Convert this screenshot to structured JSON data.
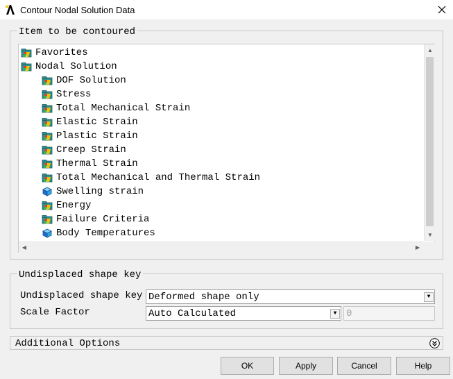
{
  "window": {
    "title": "Contour Nodal Solution Data"
  },
  "icons": {
    "logo": "ansys-logo-icon",
    "close": "close-icon",
    "folder": "folder-icon",
    "leaf": "cube-icon",
    "expand": "double-chevron-down-icon"
  },
  "colors": {
    "logo_yellow": "#f7c600",
    "folder_teal": "#2f8f8f",
    "leaf_blue": "#1e6fd0"
  },
  "item_group": {
    "legend": "Item to be contoured",
    "tree": [
      {
        "label": "Favorites",
        "level": 0,
        "icon": "folder"
      },
      {
        "label": "Nodal Solution",
        "level": 0,
        "icon": "folder-open"
      },
      {
        "label": "DOF Solution",
        "level": 1,
        "icon": "folder"
      },
      {
        "label": "Stress",
        "level": 1,
        "icon": "folder"
      },
      {
        "label": "Total Mechanical Strain",
        "level": 1,
        "icon": "folder"
      },
      {
        "label": "Elastic Strain",
        "level": 1,
        "icon": "folder"
      },
      {
        "label": "Plastic Strain",
        "level": 1,
        "icon": "folder"
      },
      {
        "label": "Creep Strain",
        "level": 1,
        "icon": "folder"
      },
      {
        "label": "Thermal Strain",
        "level": 1,
        "icon": "folder"
      },
      {
        "label": "Total Mechanical and Thermal Strain",
        "level": 1,
        "icon": "folder"
      },
      {
        "label": "Swelling strain",
        "level": 1,
        "icon": "leaf"
      },
      {
        "label": "Energy",
        "level": 1,
        "icon": "folder"
      },
      {
        "label": "Failure Criteria",
        "level": 1,
        "icon": "folder"
      },
      {
        "label": "Body Temperatures",
        "level": 1,
        "icon": "leaf"
      }
    ]
  },
  "shape_group": {
    "legend": "Undisplaced shape key",
    "shape_key_label": "Undisplaced shape key",
    "shape_key_value": "Deformed shape only",
    "scale_label": "Scale Factor",
    "scale_value": "Auto Calculated",
    "scale_field_value": "0"
  },
  "additional": {
    "label": "Additional Options"
  },
  "buttons": {
    "ok": "OK",
    "apply": "Apply",
    "cancel": "Cancel",
    "help": "Help"
  }
}
